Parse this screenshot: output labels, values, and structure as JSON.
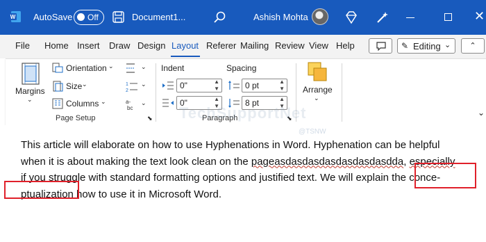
{
  "titlebar": {
    "autosave_label": "AutoSave",
    "autosave_state": "Off",
    "document_name": "Document1...",
    "user_name": "Ashish Mohta",
    "accent": "#185abd"
  },
  "tabs": [
    {
      "label": "File"
    },
    {
      "label": "Home"
    },
    {
      "label": "Insert"
    },
    {
      "label": "Draw"
    },
    {
      "label": "Design"
    },
    {
      "label": "Layout"
    },
    {
      "label": "Referer"
    },
    {
      "label": "Mailing"
    },
    {
      "label": "Review"
    },
    {
      "label": "View"
    },
    {
      "label": "Help"
    }
  ],
  "active_tab": "Layout",
  "editing_button": {
    "label": "Editing"
  },
  "ribbon": {
    "page_setup": {
      "margins_label": "Margins",
      "orientation_label": "Orientation",
      "size_label": "Size",
      "columns_label": "Columns",
      "group_label": "Page Setup"
    },
    "paragraph": {
      "indent_label": "Indent",
      "spacing_label": "Spacing",
      "indent_left": "0\"",
      "indent_right": "0\"",
      "spacing_before": "0 pt",
      "spacing_after": "8 pt",
      "group_label": "Paragraph"
    },
    "arrange": {
      "label": "Arrange"
    }
  },
  "watermark": {
    "text": "TechSupportNet",
    "sub": "@TSNW"
  },
  "document": {
    "line1": "This article will elaborate on how to use Hyphenations in Word. Hyphenation can be helpful",
    "line2a": "when it is about making the text look clean on the ",
    "line2b": "pageasdasdasdasdasdasdasdda",
    "line2c": ", ",
    "line2d": "especially",
    "line3": "if you struggle with standard formatting options and justified text. We will explain the ",
    "line3b": "conce-",
    "line4a": "ptualization",
    "line4b": " how to use it in Microsoft Word."
  }
}
